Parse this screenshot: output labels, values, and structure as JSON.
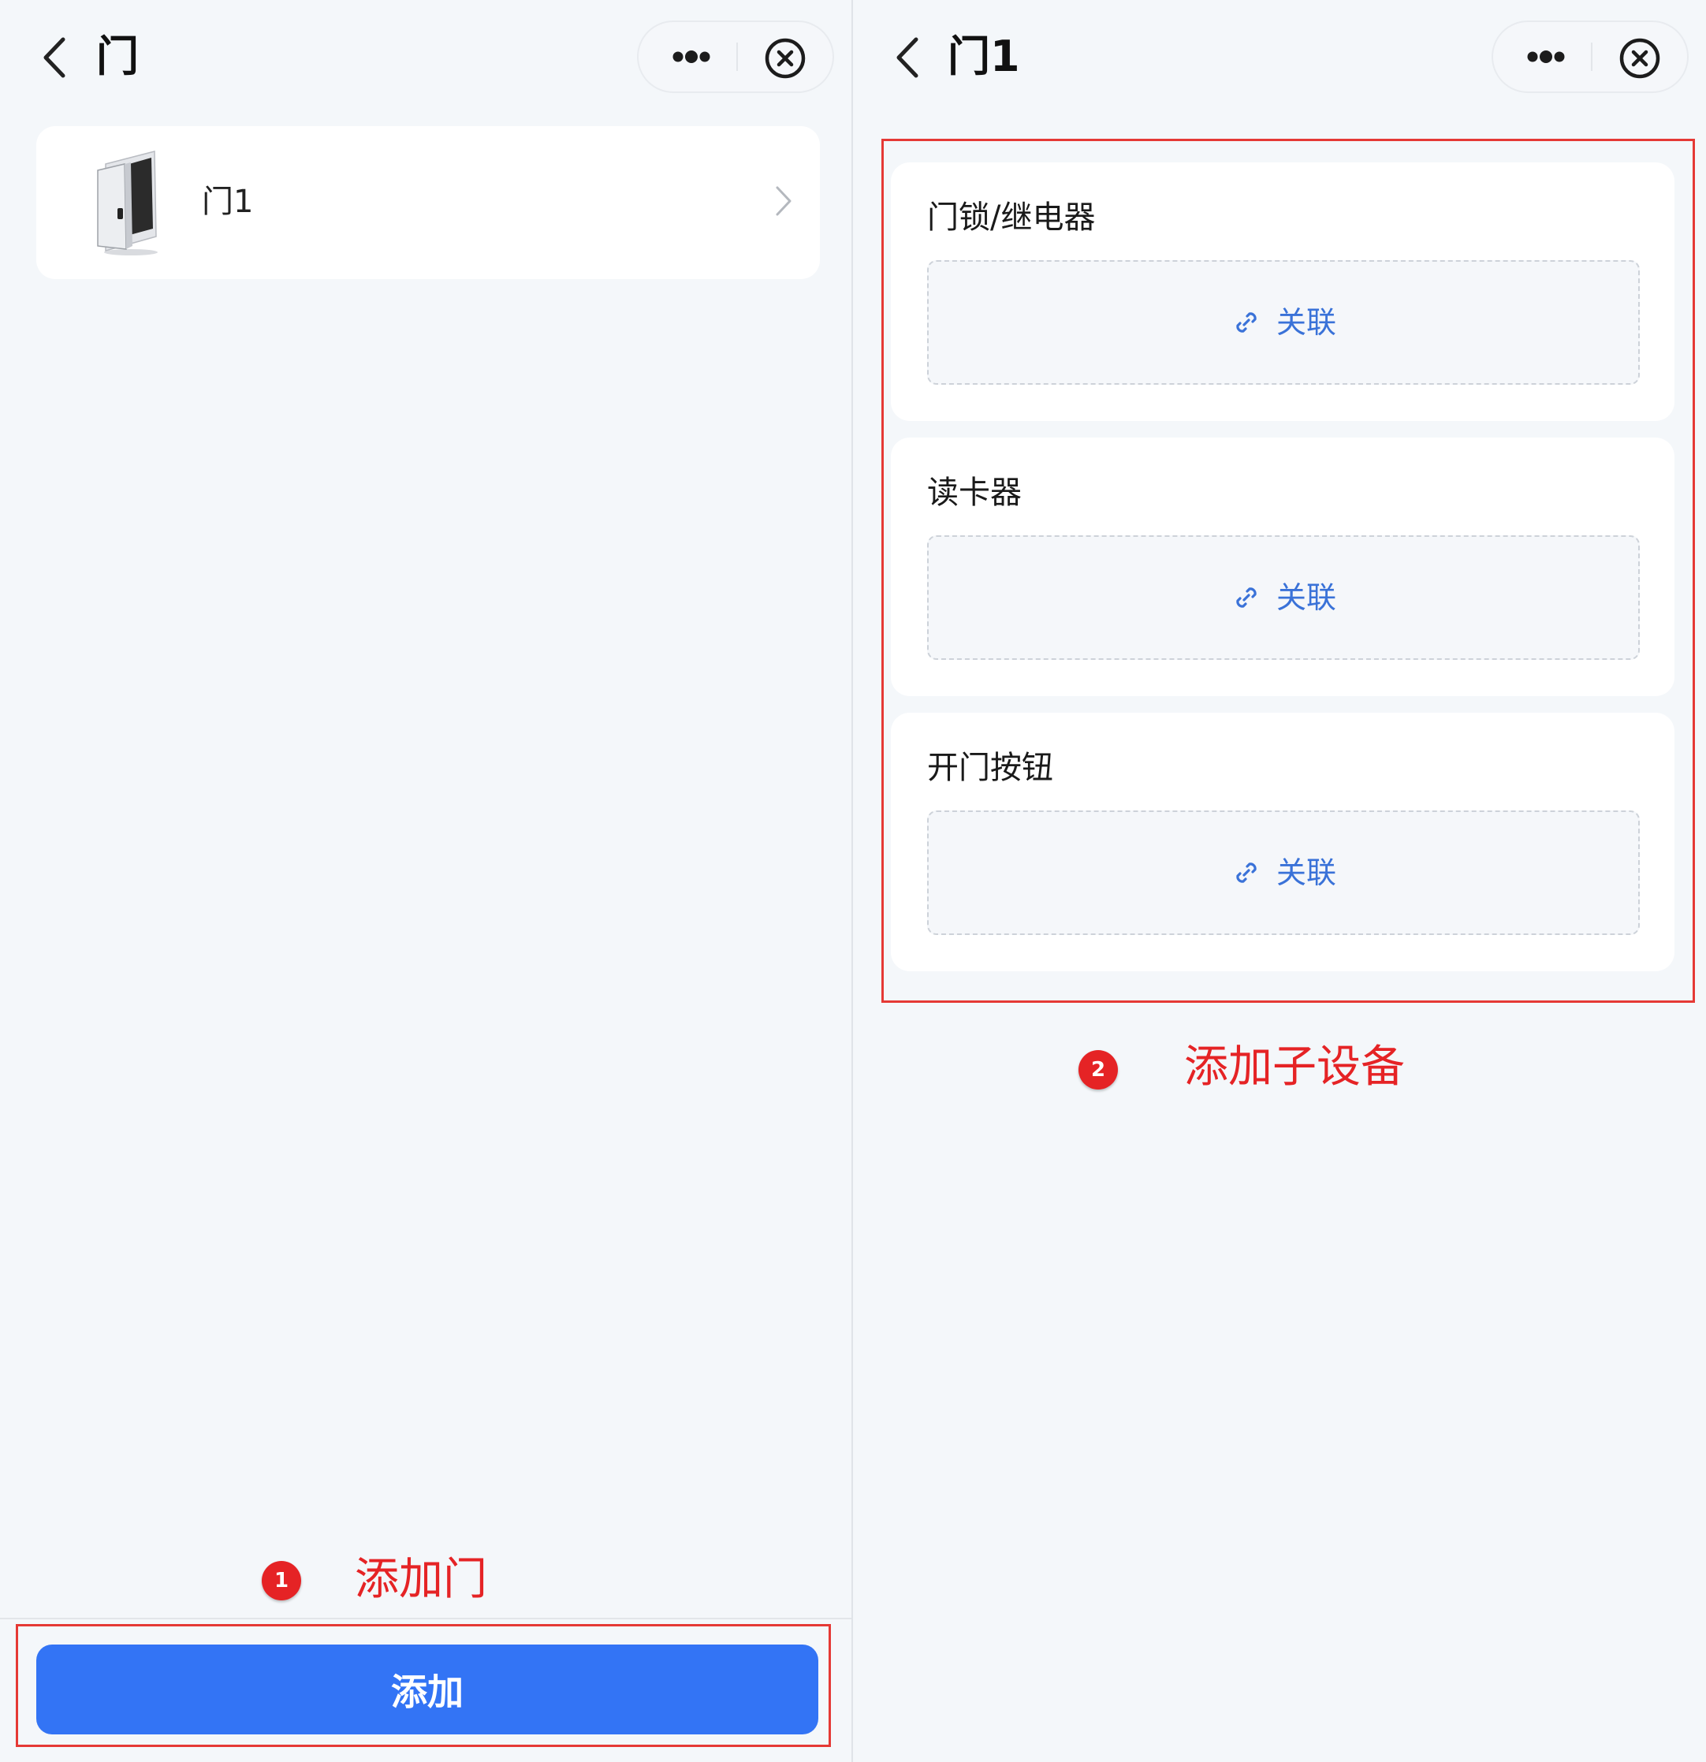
{
  "left_screen": {
    "nav_title": "门",
    "door_list": [
      {
        "name": "门1"
      }
    ],
    "add_button_label": "添加",
    "callout": {
      "badge": "1",
      "text": "添加门"
    }
  },
  "right_screen": {
    "nav_title": "门1",
    "sections": [
      {
        "title": "门锁/继电器",
        "link_label": "关联"
      },
      {
        "title": "读卡器",
        "link_label": "关联"
      },
      {
        "title": "开门按钮",
        "link_label": "关联"
      }
    ],
    "callout": {
      "badge": "2",
      "text": "添加子设备"
    }
  },
  "colors": {
    "primary_button": "#3374f5",
    "link_text": "#3a72d8",
    "annotation_red": "#e52325",
    "page_background": "#f4f7fa"
  },
  "icons": [
    "back-arrow-icon",
    "more-dots-icon",
    "close-circle-icon",
    "door-icon",
    "chevron-right-icon",
    "link-icon"
  ]
}
